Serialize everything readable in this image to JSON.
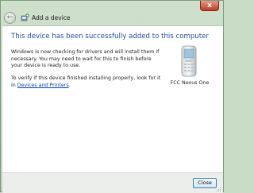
{
  "window": {
    "title": "Add a device",
    "close_glyph": "x"
  },
  "nav": {
    "back_icon": "back-arrow-icon",
    "back_glyph": "←",
    "wizard_icon": "add-device-icon"
  },
  "content": {
    "heading": "This device has been successfully added to this computer",
    "paragraph1": "Windows is now checking for drivers and will install them if necessary. You may need to wait for this to finish before your device is ready to use.",
    "paragraph2_prefix": "To verify if this device finished installing properly, look for it in",
    "link_text": "Devices and Printers",
    "link_suffix": "."
  },
  "device": {
    "icon": "mobile-phone-icon",
    "label": "FCC Nexus One"
  },
  "footer": {
    "close_label": "Close"
  },
  "colors": {
    "heading": "#1f4e9d",
    "link": "#0645ad",
    "chrome": "#c9dcc6"
  }
}
